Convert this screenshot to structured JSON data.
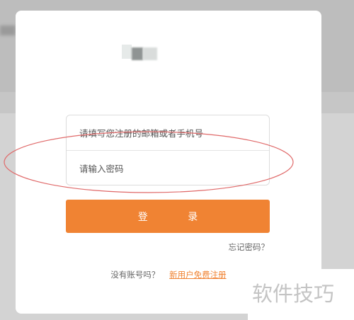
{
  "login_form": {
    "email_placeholder": "请填写您注册的邮箱或者手机号",
    "password_placeholder": "请输入密码",
    "login_button": "登 录",
    "forgot_password": "忘记密码？"
  },
  "register": {
    "prompt": "没有账号吗？",
    "link": "新用户免费注册"
  },
  "watermark": "软件技巧",
  "colors": {
    "accent": "#f08333",
    "annotation": "#e06a6a"
  },
  "icons": {
    "logo": "blurred-logo"
  }
}
